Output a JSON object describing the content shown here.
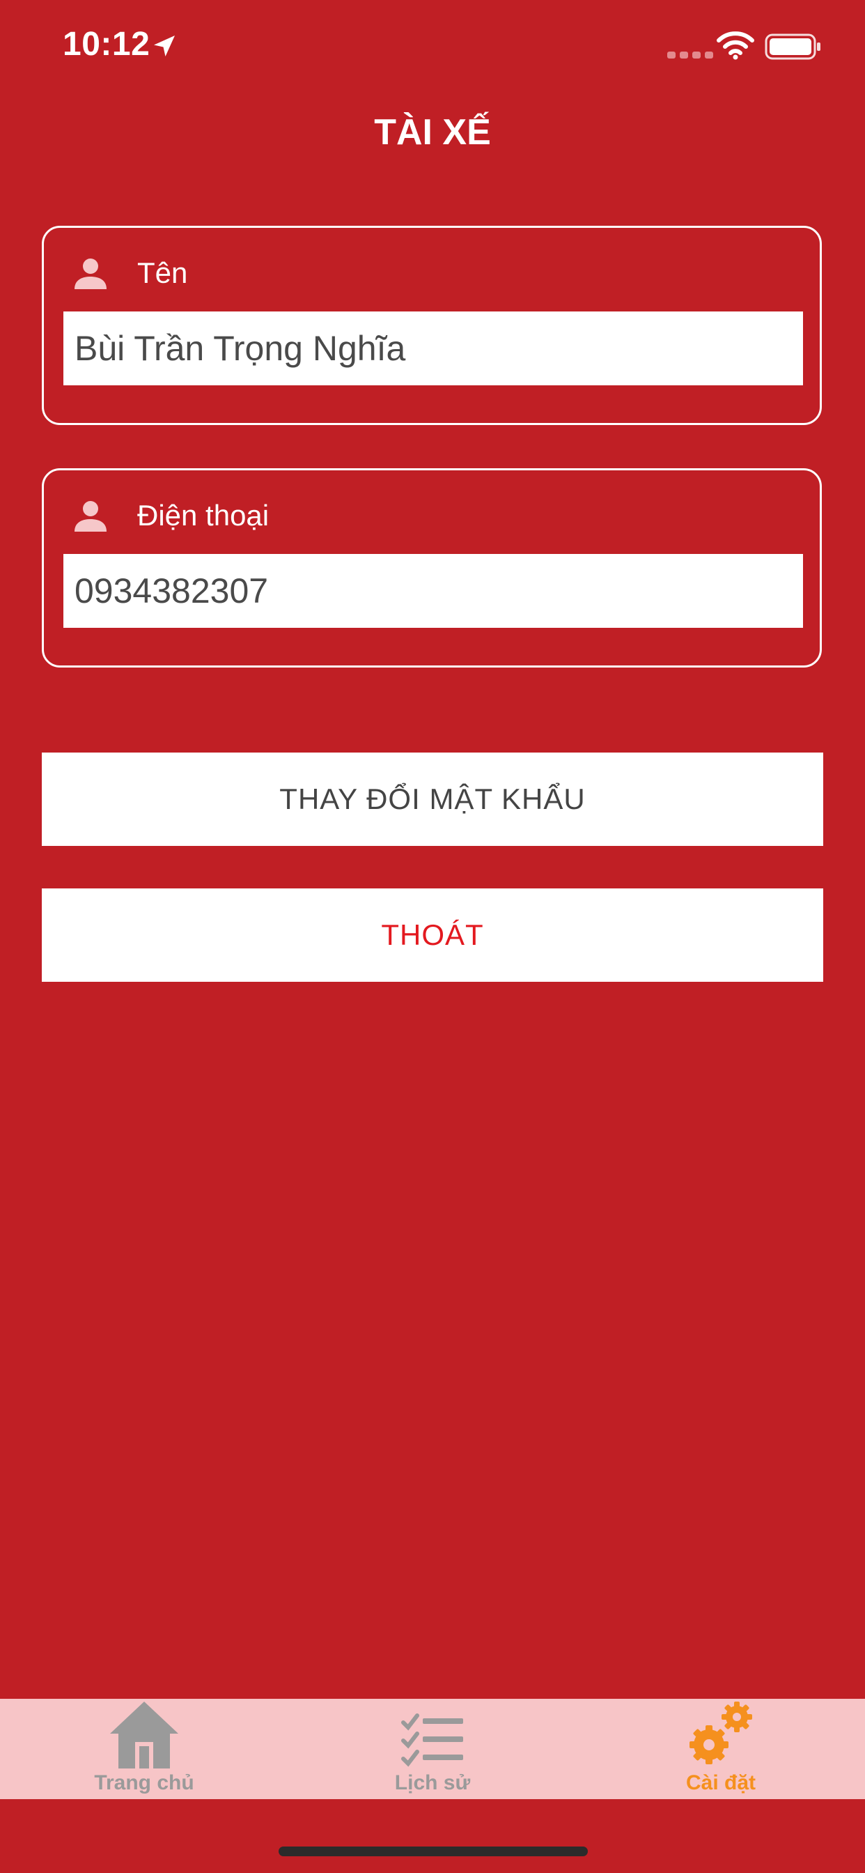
{
  "status": {
    "time": "10:12"
  },
  "header": {
    "title": "TÀI XẾ"
  },
  "form": {
    "name": {
      "label": "Tên",
      "value": "Bùi Trần Trọng Nghĩa"
    },
    "phone": {
      "label": "Điện thoại",
      "value": "0934382307"
    }
  },
  "actions": {
    "change_password": "THAY ĐỔI MẬT KHẨU",
    "logout": "THOÁT"
  },
  "tabs": [
    {
      "label": "Trang chủ",
      "icon": "home-icon",
      "active": false
    },
    {
      "label": "Lịch sử",
      "icon": "checklist-icon",
      "active": false
    },
    {
      "label": "Cài đặt",
      "icon": "gears-icon",
      "active": true
    }
  ],
  "colors": {
    "background": "#c01f25",
    "tab_bar": "#f7c5c7",
    "tab_active": "#f5901e",
    "tab_inactive": "#9a9a9a",
    "logout_text": "#e3191f"
  }
}
